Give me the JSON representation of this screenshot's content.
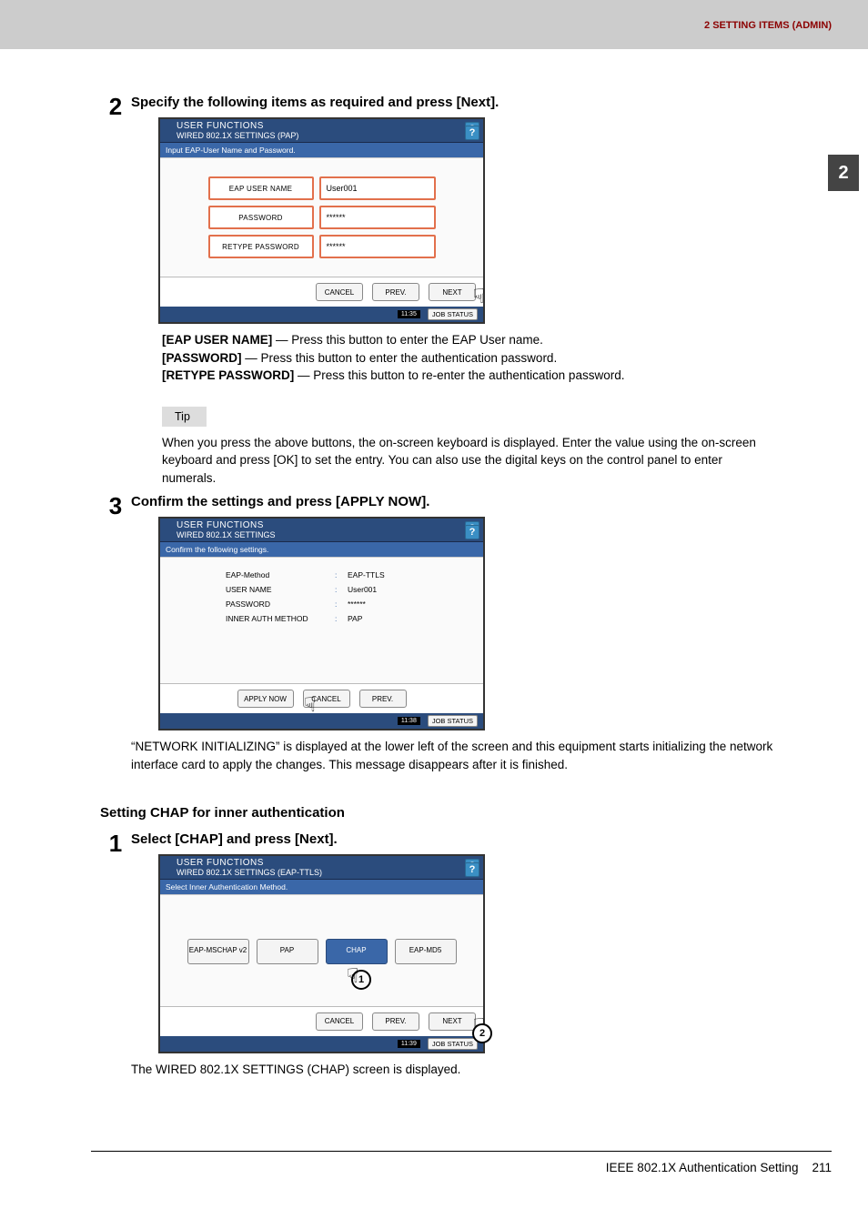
{
  "header_band": "2 SETTING ITEMS (ADMIN)",
  "side_tab": "2",
  "step2": {
    "num": "2",
    "title": "Specify the following items as required and press [Next].",
    "panel": {
      "uf": "USER FUNCTIONS",
      "sub": "WIRED 802.1X SETTINGS (PAP)",
      "bar": "Input EAP-User Name and Password.",
      "rows": [
        {
          "label": "EAP USER NAME",
          "value": "User001"
        },
        {
          "label": "PASSWORD",
          "value": "******"
        },
        {
          "label": "RETYPE PASSWORD",
          "value": "******"
        }
      ],
      "cancel": "CANCEL",
      "prev": "PREV.",
      "next": "NEXT",
      "time": "11:35",
      "job": "JOB STATUS"
    },
    "desc_lines": [
      {
        "b": "[EAP USER NAME]",
        "t": " — Press this button to enter the EAP User name."
      },
      {
        "b": "[PASSWORD]",
        "t": " — Press this button to enter the authentication password."
      },
      {
        "b": "[RETYPE PASSWORD]",
        "t": " — Press this button to re-enter the authentication password."
      }
    ],
    "tip_label": "Tip",
    "tip_text": "When you press the above buttons, the on-screen keyboard is displayed. Enter the value using the on-screen keyboard and press [OK] to set the entry. You can also use the digital keys on the control panel to enter numerals."
  },
  "step3": {
    "num": "3",
    "title": "Confirm the settings and press [APPLY NOW].",
    "panel": {
      "uf": "USER FUNCTIONS",
      "sub": "WIRED 802.1X SETTINGS",
      "bar": "Confirm the following settings.",
      "kv": [
        {
          "k": "EAP-Method",
          "v": "EAP-TTLS"
        },
        {
          "k": "USER NAME",
          "v": "User001"
        },
        {
          "k": "PASSWORD",
          "v": "******"
        },
        {
          "k": "INNER AUTH METHOD",
          "v": "PAP"
        }
      ],
      "apply": "APPLY NOW",
      "cancel": "CANCEL",
      "prev": "PREV.",
      "time": "11:38",
      "job": "JOB STATUS"
    },
    "desc": "“NETWORK INITIALIZING” is displayed at the lower left of the screen and this equipment starts initializing the network interface card to apply the changes. This message disappears after it is finished."
  },
  "section_heading": "Setting CHAP for inner authentication",
  "step1b": {
    "num": "1",
    "title": "Select [CHAP] and press [Next].",
    "panel": {
      "uf": "USER FUNCTIONS",
      "sub": "WIRED 802.1X SETTINGS (EAP-TTLS)",
      "bar": "Select Inner Authentication Method.",
      "opts": [
        "EAP-MSCHAP v2",
        "PAP",
        "CHAP",
        "EAP-MD5"
      ],
      "cancel": "CANCEL",
      "prev": "PREV.",
      "next": "NEXT",
      "time": "11:39",
      "job": "JOB STATUS"
    },
    "desc": "The WIRED 802.1X SETTINGS (CHAP) screen is displayed."
  },
  "footer": {
    "left": "IEEE 802.1X Authentication Setting",
    "page": "211"
  }
}
